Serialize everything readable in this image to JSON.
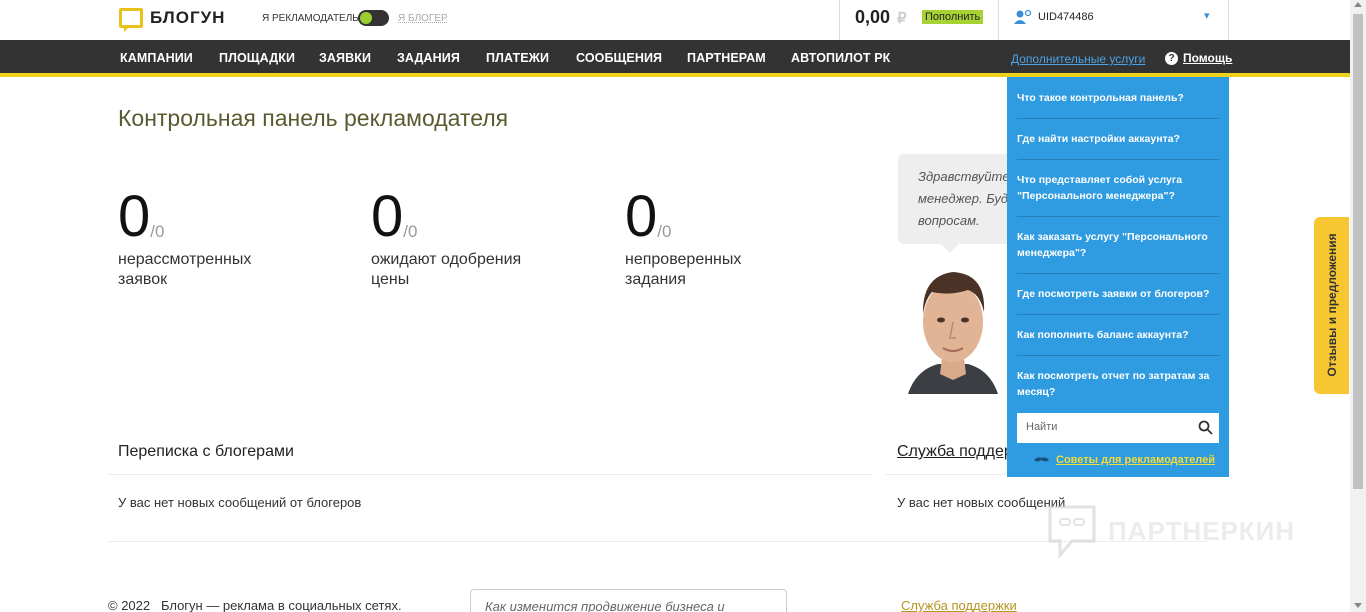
{
  "header": {
    "logo_text": "БЛОГУН",
    "role_advertiser": "Я РЕКЛАМОДАТЕЛЬ",
    "role_blogger": "Я БЛОГЕР",
    "balance_value": "0,00",
    "balance_currency": "₽",
    "topup_label": "Пополнить",
    "user_id": "UID474486"
  },
  "nav": {
    "items": [
      "КАМПАНИИ",
      "ПЛОЩАДКИ",
      "ЗАЯВКИ",
      "ЗАДАНИЯ",
      "ПЛАТЕЖИ",
      "СООБЩЕНИЯ",
      "ПАРТНЕРАМ",
      "АВТОПИЛОТ РК"
    ],
    "extra_link": "Дополнительные услуги",
    "help_label": "Помощь"
  },
  "main": {
    "title": "Контрольная панель рекламодателя",
    "stats": [
      {
        "value": "0",
        "total": "/0",
        "label": "нерассмотренных заявок"
      },
      {
        "value": "0",
        "total": "/0",
        "label": "ожидают одобрения цены"
      },
      {
        "value": "0",
        "total": "/0",
        "label": "непроверенных задания"
      }
    ],
    "manager_speech": [
      "Здравствуйте,",
      "менеджер. Буду",
      "вопросам."
    ],
    "correspondence_title": "Переписка с блогерами",
    "correspondence_text": "У вас нет новых сообщений от блогеров",
    "support_title": "Служба поддержки",
    "support_text": "У вас нет новых сообщений"
  },
  "footer": {
    "copyright": "© 2022   Блогун — реклама в социальных сетях.",
    "input_text": "Как изменится продвижение бизнеса и",
    "support_link": "Служба поддержки"
  },
  "help_menu": {
    "items": [
      "Что такое контрольная панель?",
      "Где найти настройки аккаунта?",
      "Что представляет собой услуга \"Персонального менеджера\"?",
      "Как заказать услугу \"Персонального менеджера\"?",
      "Где посмотреть заявки от блогеров?",
      "Как пополнить баланс аккаунта?",
      "Как посмотреть отчет по затратам за месяц?"
    ],
    "search_placeholder": "Найти",
    "tips_link": "Советы для рекламодателей"
  },
  "feedback_tab": "Отзывы и предложения",
  "watermark_text": "ПАРТНЕРКИН",
  "colors": {
    "nav_bg": "#333333",
    "accent_yellow": "#f0d21c",
    "help_panel": "#2f9be0",
    "topup_green": "#a8d234"
  }
}
